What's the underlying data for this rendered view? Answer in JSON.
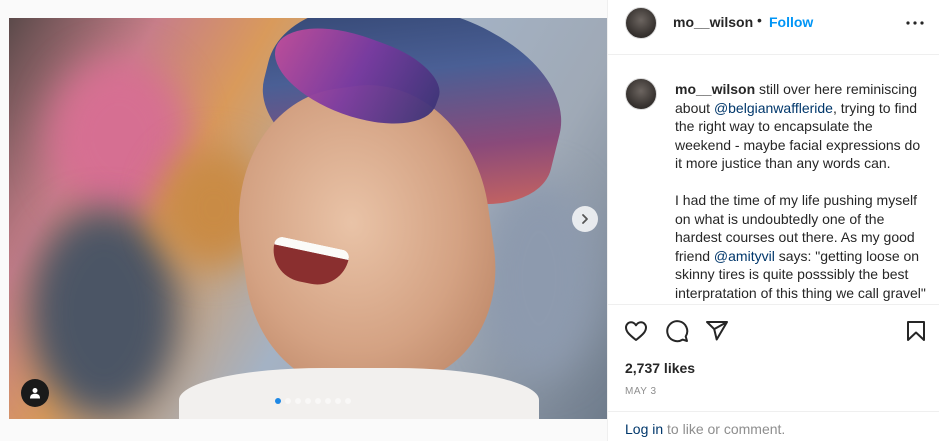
{
  "post": {
    "username": "mo__wilson",
    "separator": "•",
    "follow_label": "Follow",
    "media": {
      "carousel_dots": 8,
      "active_dot": 0
    },
    "caption": {
      "author": "mo__wilson",
      "p1_text_a": " still over here reminiscing about ",
      "mention_1": "@belgianwaffleride",
      "p1_text_b": ", trying to find the right way to encapsulate the weekend - maybe facial expressions do it more justice than any words can.",
      "p2_text_a": "I had the time of my life pushing myself on what is undoubtedly one of the hardest courses out there. As my good friend ",
      "mention_2": "@amityvil",
      "p2_text_b": " says: \"getting loose on skinny tires is quite posssibly the best interpratation of this thing we call gravel\" - and I couldn't"
    },
    "likes": "2,737 likes",
    "date": "MAY 3",
    "login_link": "Log in",
    "login_suffix": " to like or comment."
  },
  "colors": {
    "accent": "#0095f6",
    "link": "#00376b",
    "text": "#262626",
    "muted": "#8e8e8e"
  },
  "icons": {
    "like": "heart-icon",
    "comment": "comment-icon",
    "share": "paper-plane-icon",
    "save": "bookmark-icon",
    "more": "more-horizontal-icon",
    "next": "chevron-right-icon",
    "tags": "user-tag-icon"
  }
}
